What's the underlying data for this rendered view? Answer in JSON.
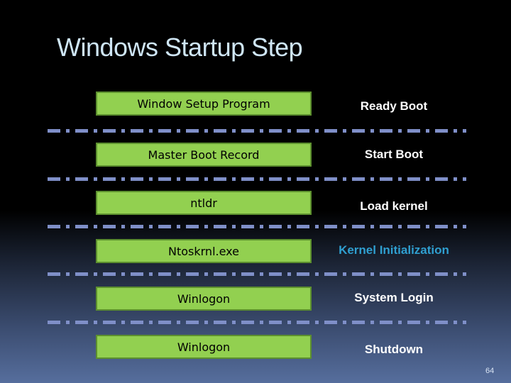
{
  "slide": {
    "title": "Windows Startup Step",
    "page_number": "64",
    "steps": [
      {
        "component": "Window Setup Program",
        "stage": "Ready Boot",
        "highlight": false
      },
      {
        "component": "Master Boot Record",
        "stage": "Start Boot",
        "highlight": false
      },
      {
        "component": "ntldr",
        "stage": "Load kernel",
        "highlight": false
      },
      {
        "component": "Ntoskrnl.exe",
        "stage": "Kernel Initialization",
        "highlight": true
      },
      {
        "component": "Winlogon",
        "stage": "System Login",
        "highlight": false
      },
      {
        "component": "Winlogon",
        "stage": "Shutdown",
        "highlight": false
      }
    ],
    "colors": {
      "box_fill": "#92d050",
      "box_border": "#5c8f2e",
      "divider": "#7f8fc8",
      "accent_label": "#2f9fd0",
      "title": "#cfe6f5"
    }
  }
}
